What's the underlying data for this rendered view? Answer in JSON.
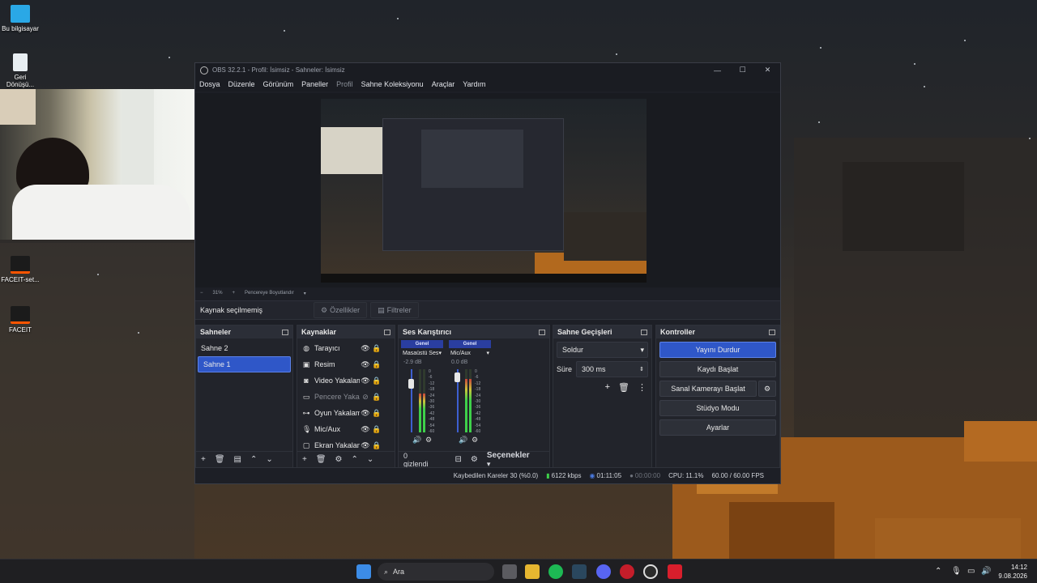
{
  "desktop": {
    "icons": [
      {
        "label": "Bu bilgisayar"
      },
      {
        "label": "Geri Dönüşü..."
      },
      {
        "label": "FACEIT-set..."
      },
      {
        "label": "FACEIT"
      }
    ]
  },
  "obs": {
    "title": "OBS 32.2.1 - Profil: İsimsiz - Sahneler: İsimsiz",
    "window_controls": {
      "minimize": "—",
      "maximize": "☐",
      "close": "✕"
    },
    "menu": [
      "Dosya",
      "Düzenle",
      "Görünüm",
      "Paneller",
      "Profil",
      "Sahne Koleksiyonu",
      "Araçlar",
      "Yardım"
    ],
    "menu_disabled": "Profil",
    "zoom": {
      "minus": "−",
      "value": "31%",
      "plus": "+",
      "fit": "Pencereye Boyutlandır"
    },
    "source_bar": {
      "no_selection": "Kaynak seçilmemiş",
      "properties": "Özellikler",
      "filters": "Filtreler"
    },
    "scenes": {
      "title": "Sahneler",
      "items": [
        "Sahne 2",
        "Sahne 1"
      ],
      "selected": "Sahne 1"
    },
    "sources": {
      "title": "Kaynaklar",
      "items": [
        {
          "name": "Tarayıcı",
          "icon": "globe-icon",
          "visible": true
        },
        {
          "name": "Resim",
          "icon": "image-icon",
          "visible": true
        },
        {
          "name": "Video Yakalama",
          "icon": "camera-icon",
          "visible": true
        },
        {
          "name": "Pencere Yakalama",
          "icon": "window-icon",
          "visible": false
        },
        {
          "name": "Oyun Yakalama",
          "icon": "gamepad-icon",
          "visible": true
        },
        {
          "name": "Mic/Aux",
          "icon": "mic-icon",
          "visible": true
        },
        {
          "name": "Ekran Yakalama",
          "icon": "monitor-icon",
          "visible": true
        }
      ]
    },
    "mixer": {
      "title": "Ses Karıştırıcı",
      "channels": [
        {
          "tag": "Genel",
          "name": "Masaüstü Ses",
          "db": "-2.9 dB",
          "level": 0.62
        },
        {
          "tag": "Genel",
          "name": "Mic/Aux",
          "db": "0.0 dB",
          "level": 0.85
        }
      ],
      "scale": [
        "0",
        "-6",
        "-12",
        "-18",
        "-24",
        "-30",
        "-36",
        "-42",
        "-48",
        "-54",
        "-60"
      ],
      "hidden_count": "0 gizlendi",
      "options": "Seçenekler"
    },
    "transitions": {
      "title": "Sahne Geçişleri",
      "type": "Soldur",
      "duration_label": "Süre",
      "duration": "300 ms"
    },
    "controls": {
      "title": "Kontroller",
      "stop_stream": "Yayını Durdur",
      "start_record": "Kaydı Başlat",
      "start_virtualcam": "Sanal Kamerayı Başlat",
      "studio_mode": "Stüdyo Modu",
      "settings": "Ayarlar"
    },
    "status": {
      "dropped": "Kaybedilen Kareler 30 (%0.0)",
      "bitrate": "6122 kbps",
      "stream_time": "01:11:05",
      "record_time": "00:00:00",
      "cpu": "CPU: 11.1%",
      "fps": "60.00 / 60.00 FPS"
    }
  },
  "taskbar": {
    "search_placeholder": "Ara",
    "time": "14:12",
    "date": "9.08.2026"
  },
  "colors": {
    "accent": "#2f57c8",
    "panel": "#22242b",
    "window": "#1d1f26"
  }
}
